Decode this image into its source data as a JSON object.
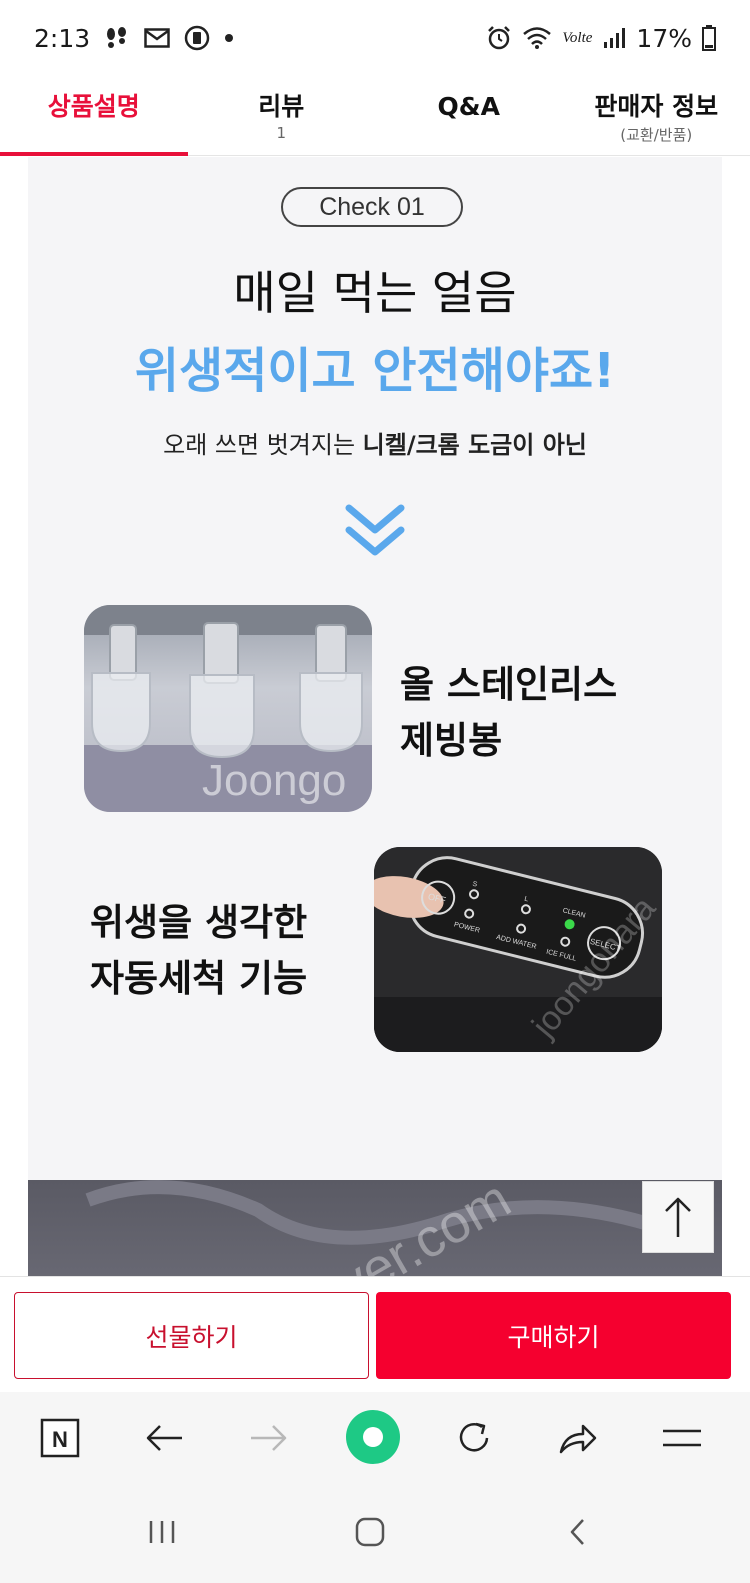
{
  "status_bar": {
    "time": "2:13",
    "battery_percent": "17%",
    "network_label": "Volte"
  },
  "tabs": [
    {
      "label": "상품설명",
      "sub": ""
    },
    {
      "label": "리뷰",
      "sub": "1"
    },
    {
      "label": "Q&A",
      "sub": ""
    },
    {
      "label": "판매자 정보",
      "sub": "(교환/반품)"
    }
  ],
  "content": {
    "check_label": "Check 01",
    "headline_1": "매일 먹는 얼음",
    "headline_2": "위생적이고 안전해야죠!",
    "subline_normal": "오래 쓰면 벗겨지는 ",
    "subline_bold": "니켈/크롬 도금이 아닌",
    "feature_1_line1": "올 스테인리스",
    "feature_1_line2": "제빙봉",
    "feature_2_line1": "위생을 생각한",
    "feature_2_line2": "자동세척 기능",
    "panel_labels": {
      "off": "OFF",
      "power": "POWER",
      "s": "S",
      "l": "L",
      "add_water": "ADD WATER",
      "clean": "CLEAN",
      "ice_full": "ICE FULL",
      "select": "SELECT"
    },
    "watermark_1": "Joongo",
    "watermark_2": "joongonara",
    "watermark_3": "naver.com"
  },
  "purchase": {
    "gift_label": "선물하기",
    "buy_label": "구매하기"
  },
  "colors": {
    "accent_red": "#e8103a",
    "buy_red": "#f5002f",
    "headline_blue": "#5aa8ec",
    "green_home": "#1ec985"
  },
  "icons": {
    "naver": "N"
  }
}
